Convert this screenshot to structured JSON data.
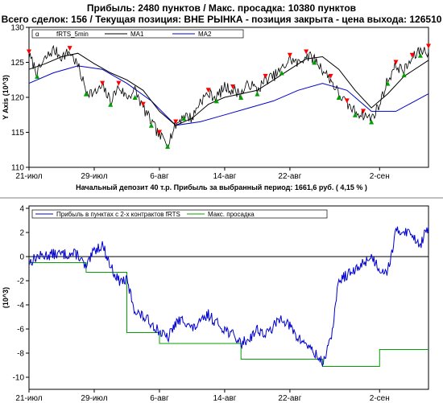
{
  "header": {
    "line1": "Прибыль: 2480 пунктов / Макс. просадка: 10380 пунктов",
    "line2": "Всего сделок: 156 /  Текущая позиция: ВНЕ РЫНКА - позиция закрыта  - цена выхода: 126510"
  },
  "colors": {
    "price": "#000000",
    "ma1": "#000000",
    "ma2": "#0000cc",
    "buy": "#00a000",
    "sell": "#ff0000",
    "profit": "#0000cc",
    "drawdown": "#00a000",
    "zero_line": "#000000",
    "separator": "#808080"
  },
  "chart_data": [
    {
      "type": "line",
      "ylabel": "Y Axis (10^3)",
      "ylim": [
        110,
        130
      ],
      "yticks": [
        110,
        115,
        120,
        125,
        130
      ],
      "xlim": [
        "2014-07-21",
        "2014-09-08"
      ],
      "xticks": [
        {
          "date": "2014-07-21",
          "label": "21-июл"
        },
        {
          "date": "2014-07-29",
          "label": "29-июл"
        },
        {
          "date": "2014-08-06",
          "label": "6-авг"
        },
        {
          "date": "2014-08-14",
          "label": "14-авг"
        },
        {
          "date": "2014-08-22",
          "label": "22-авг"
        },
        {
          "date": "2014-09-02",
          "label": "2-сен"
        }
      ],
      "grid": false,
      "legend": {
        "position": "top-left",
        "entries": [
          "fRTS_5min",
          "MA1",
          "MA2"
        ]
      },
      "caption": "Начальный депозит 40 т.р. Прибыль за выбранный период: 1661,6 руб. ( 4,15 % )",
      "series": [
        {
          "name": "fRTS_5min",
          "points": [
            {
              "x": "2014-07-21",
              "y": 126.0
            },
            {
              "x": "2014-07-22",
              "y": 123.5
            },
            {
              "x": "2014-07-23",
              "y": 125.5
            },
            {
              "x": "2014-07-24",
              "y": 126.8
            },
            {
              "x": "2014-07-25",
              "y": 125.8
            },
            {
              "x": "2014-07-26",
              "y": 126.5
            },
            {
              "x": "2014-07-27",
              "y": 124.5
            },
            {
              "x": "2014-07-28",
              "y": 121.0
            },
            {
              "x": "2014-07-29",
              "y": 120.5
            },
            {
              "x": "2014-07-30",
              "y": 121.5
            },
            {
              "x": "2014-07-31",
              "y": 119.5
            },
            {
              "x": "2014-08-01",
              "y": 121.5
            },
            {
              "x": "2014-08-02",
              "y": 120.0
            },
            {
              "x": "2014-08-03",
              "y": 121.0
            },
            {
              "x": "2014-08-04",
              "y": 118.5
            },
            {
              "x": "2014-08-05",
              "y": 116.5
            },
            {
              "x": "2014-08-06",
              "y": 114.5
            },
            {
              "x": "2014-08-07",
              "y": 113.5
            },
            {
              "x": "2014-08-08",
              "y": 116.0
            },
            {
              "x": "2014-08-09",
              "y": 117.5
            },
            {
              "x": "2014-08-10",
              "y": 117.0
            },
            {
              "x": "2014-08-11",
              "y": 119.5
            },
            {
              "x": "2014-08-12",
              "y": 120.5
            },
            {
              "x": "2014-08-13",
              "y": 120.0
            },
            {
              "x": "2014-08-14",
              "y": 121.5
            },
            {
              "x": "2014-08-15",
              "y": 121.0
            },
            {
              "x": "2014-08-16",
              "y": 120.5
            },
            {
              "x": "2014-08-17",
              "y": 122.0
            },
            {
              "x": "2014-08-18",
              "y": 121.0
            },
            {
              "x": "2014-08-19",
              "y": 122.5
            },
            {
              "x": "2014-08-20",
              "y": 123.0
            },
            {
              "x": "2014-08-21",
              "y": 124.0
            },
            {
              "x": "2014-08-22",
              "y": 125.5
            },
            {
              "x": "2014-08-23",
              "y": 124.8
            },
            {
              "x": "2014-08-24",
              "y": 126.0
            },
            {
              "x": "2014-08-25",
              "y": 125.5
            },
            {
              "x": "2014-08-26",
              "y": 124.0
            },
            {
              "x": "2014-08-27",
              "y": 122.5
            },
            {
              "x": "2014-08-28",
              "y": 120.5
            },
            {
              "x": "2014-08-29",
              "y": 119.0
            },
            {
              "x": "2014-08-30",
              "y": 118.0
            },
            {
              "x": "2014-08-31",
              "y": 117.5
            },
            {
              "x": "2014-09-01",
              "y": 117.0
            },
            {
              "x": "2014-09-02",
              "y": 119.0
            },
            {
              "x": "2014-09-03",
              "y": 122.5
            },
            {
              "x": "2014-09-04",
              "y": 124.5
            },
            {
              "x": "2014-09-05",
              "y": 123.8
            },
            {
              "x": "2014-09-06",
              "y": 125.5
            },
            {
              "x": "2014-09-07",
              "y": 126.8
            },
            {
              "x": "2014-09-08",
              "y": 126.5
            }
          ]
        },
        {
          "name": "MA1",
          "points": [
            {
              "x": "2014-07-21",
              "y": 124.0
            },
            {
              "x": "2014-07-23",
              "y": 124.8
            },
            {
              "x": "2014-07-25",
              "y": 125.8
            },
            {
              "x": "2014-07-27",
              "y": 126.3
            },
            {
              "x": "2014-07-29",
              "y": 124.8
            },
            {
              "x": "2014-07-31",
              "y": 123.5
            },
            {
              "x": "2014-08-02",
              "y": 122.5
            },
            {
              "x": "2014-08-04",
              "y": 121.0
            },
            {
              "x": "2014-08-06",
              "y": 118.0
            },
            {
              "x": "2014-08-08",
              "y": 116.0
            },
            {
              "x": "2014-08-10",
              "y": 117.0
            },
            {
              "x": "2014-08-12",
              "y": 119.0
            },
            {
              "x": "2014-08-14",
              "y": 120.0
            },
            {
              "x": "2014-08-16",
              "y": 120.5
            },
            {
              "x": "2014-08-18",
              "y": 121.0
            },
            {
              "x": "2014-08-20",
              "y": 122.5
            },
            {
              "x": "2014-08-22",
              "y": 124.0
            },
            {
              "x": "2014-08-24",
              "y": 125.5
            },
            {
              "x": "2014-08-26",
              "y": 125.8
            },
            {
              "x": "2014-08-28",
              "y": 124.0
            },
            {
              "x": "2014-08-30",
              "y": 121.0
            },
            {
              "x": "2014-09-01",
              "y": 118.5
            },
            {
              "x": "2014-09-03",
              "y": 120.5
            },
            {
              "x": "2014-09-05",
              "y": 123.0
            },
            {
              "x": "2014-09-08",
              "y": 125.3
            }
          ]
        },
        {
          "name": "MA2",
          "points": [
            {
              "x": "2014-07-21",
              "y": 122.0
            },
            {
              "x": "2014-07-24",
              "y": 123.5
            },
            {
              "x": "2014-07-27",
              "y": 124.5
            },
            {
              "x": "2014-07-30",
              "y": 124.0
            },
            {
              "x": "2014-08-02",
              "y": 122.0
            },
            {
              "x": "2014-08-05",
              "y": 119.5
            },
            {
              "x": "2014-08-08",
              "y": 116.0
            },
            {
              "x": "2014-08-11",
              "y": 116.5
            },
            {
              "x": "2014-08-14",
              "y": 117.5
            },
            {
              "x": "2014-08-17",
              "y": 118.5
            },
            {
              "x": "2014-08-20",
              "y": 119.5
            },
            {
              "x": "2014-08-23",
              "y": 121.0
            },
            {
              "x": "2014-08-26",
              "y": 122.0
            },
            {
              "x": "2014-08-29",
              "y": 121.0
            },
            {
              "x": "2014-09-01",
              "y": 118.0
            },
            {
              "x": "2014-09-04",
              "y": 118.0
            },
            {
              "x": "2014-09-08",
              "y": 120.5
            }
          ]
        }
      ],
      "signals": {
        "buy": [
          {
            "x": "2014-07-22",
            "y": 123.0
          },
          {
            "x": "2014-07-28",
            "y": 120.5
          },
          {
            "x": "2014-07-31",
            "y": 119.0
          },
          {
            "x": "2014-08-03",
            "y": 120.0
          },
          {
            "x": "2014-08-05",
            "y": 116.0
          },
          {
            "x": "2014-08-07",
            "y": 113.0
          },
          {
            "x": "2014-08-09",
            "y": 117.0
          },
          {
            "x": "2014-08-13",
            "y": 119.5
          },
          {
            "x": "2014-08-16",
            "y": 120.0
          },
          {
            "x": "2014-08-18",
            "y": 120.5
          },
          {
            "x": "2014-08-21",
            "y": 123.5
          },
          {
            "x": "2014-08-25",
            "y": 125.0
          },
          {
            "x": "2014-08-28",
            "y": 120.0
          },
          {
            "x": "2014-08-30",
            "y": 117.5
          },
          {
            "x": "2014-09-01",
            "y": 116.5
          },
          {
            "x": "2014-09-03",
            "y": 122.0
          },
          {
            "x": "2014-09-05",
            "y": 123.2
          },
          {
            "x": "2014-09-07",
            "y": 126.0
          }
        ],
        "sell": [
          {
            "x": "2014-07-21",
            "y": 126.5
          },
          {
            "x": "2014-07-26",
            "y": 127.0
          },
          {
            "x": "2014-07-30",
            "y": 122.0
          },
          {
            "x": "2014-08-01",
            "y": 122.0
          },
          {
            "x": "2014-08-04",
            "y": 119.0
          },
          {
            "x": "2014-08-06",
            "y": 115.0
          },
          {
            "x": "2014-08-08",
            "y": 116.5
          },
          {
            "x": "2014-08-12",
            "y": 121.0
          },
          {
            "x": "2014-08-15",
            "y": 121.5
          },
          {
            "x": "2014-08-19",
            "y": 123.0
          },
          {
            "x": "2014-08-22",
            "y": 126.0
          },
          {
            "x": "2014-08-24",
            "y": 126.5
          },
          {
            "x": "2014-08-27",
            "y": 123.0
          },
          {
            "x": "2014-08-29",
            "y": 119.5
          },
          {
            "x": "2014-08-31",
            "y": 118.0
          },
          {
            "x": "2014-09-04",
            "y": 125.0
          },
          {
            "x": "2014-09-06",
            "y": 126.0
          },
          {
            "x": "2014-09-08",
            "y": 127.3
          }
        ]
      }
    },
    {
      "type": "line",
      "ylabel": "(10^3)",
      "ylim": [
        -11,
        4.2
      ],
      "yticks": [
        {
          "value": 4,
          "label": "4"
        },
        {
          "value": 2,
          "label": "2"
        },
        {
          "value": 0,
          "label": "0"
        },
        {
          "value": -2,
          "label": "-2"
        },
        {
          "value": -4,
          "label": "-4"
        },
        {
          "value": -6,
          "label": "-6"
        },
        {
          "value": -8,
          "label": "-8"
        },
        {
          "value": -10,
          "label": "-10"
        }
      ],
      "xlim": [
        "2014-07-21",
        "2014-09-08"
      ],
      "xticks": [
        {
          "date": "2014-07-21",
          "label": "21-июл"
        },
        {
          "date": "2014-07-29",
          "label": "29-июл"
        },
        {
          "date": "2014-08-06",
          "label": "6-авг"
        },
        {
          "date": "2014-08-14",
          "label": "14-авг"
        },
        {
          "date": "2014-08-22",
          "label": "22-авг"
        },
        {
          "date": "2014-09-02",
          "label": "2-сен"
        }
      ],
      "grid": false,
      "legend": {
        "position": "top-left",
        "entries": [
          "Прибыль в пунктах с 2-х контрактов fRTS",
          "Макс. просадка"
        ]
      },
      "series": [
        {
          "name": "Прибыль в пунктах с 2-х контрактов fRTS",
          "points": [
            {
              "x": "2014-07-21",
              "y": -0.5
            },
            {
              "x": "2014-07-22",
              "y": 0.0
            },
            {
              "x": "2014-07-24",
              "y": 0.2
            },
            {
              "x": "2014-07-27",
              "y": 0.2
            },
            {
              "x": "2014-07-28",
              "y": -1.0
            },
            {
              "x": "2014-07-29",
              "y": 0.5
            },
            {
              "x": "2014-07-30",
              "y": 1.0
            },
            {
              "x": "2014-07-31",
              "y": -0.8
            },
            {
              "x": "2014-08-01",
              "y": -2.0
            },
            {
              "x": "2014-08-02",
              "y": -2.0
            },
            {
              "x": "2014-08-03",
              "y": -4.5
            },
            {
              "x": "2014-08-04",
              "y": -5.0
            },
            {
              "x": "2014-08-05",
              "y": -5.5
            },
            {
              "x": "2014-08-06",
              "y": -6.2
            },
            {
              "x": "2014-08-07",
              "y": -6.8
            },
            {
              "x": "2014-08-08",
              "y": -5.5
            },
            {
              "x": "2014-08-09",
              "y": -5.2
            },
            {
              "x": "2014-08-10",
              "y": -6.0
            },
            {
              "x": "2014-08-11",
              "y": -5.5
            },
            {
              "x": "2014-08-12",
              "y": -4.8
            },
            {
              "x": "2014-08-13",
              "y": -5.5
            },
            {
              "x": "2014-08-14",
              "y": -6.0
            },
            {
              "x": "2014-08-15",
              "y": -6.5
            },
            {
              "x": "2014-08-16",
              "y": -7.2
            },
            {
              "x": "2014-08-17",
              "y": -6.8
            },
            {
              "x": "2014-08-18",
              "y": -6.0
            },
            {
              "x": "2014-08-19",
              "y": -6.5
            },
            {
              "x": "2014-08-20",
              "y": -5.8
            },
            {
              "x": "2014-08-21",
              "y": -5.0
            },
            {
              "x": "2014-08-22",
              "y": -5.8
            },
            {
              "x": "2014-08-23",
              "y": -6.8
            },
            {
              "x": "2014-08-24",
              "y": -7.2
            },
            {
              "x": "2014-08-25",
              "y": -8.0
            },
            {
              "x": "2014-08-26",
              "y": -8.8
            },
            {
              "x": "2014-08-27",
              "y": -7.0
            },
            {
              "x": "2014-08-28",
              "y": -2.0
            },
            {
              "x": "2014-08-29",
              "y": -1.5
            },
            {
              "x": "2014-08-30",
              "y": -1.2
            },
            {
              "x": "2014-08-31",
              "y": -0.5
            },
            {
              "x": "2014-09-01",
              "y": 0.0
            },
            {
              "x": "2014-09-02",
              "y": -1.0
            },
            {
              "x": "2014-09-03",
              "y": -1.2
            },
            {
              "x": "2014-09-04",
              "y": 2.0
            },
            {
              "x": "2014-09-05",
              "y": 2.2
            },
            {
              "x": "2014-09-06",
              "y": 1.8
            },
            {
              "x": "2014-09-07",
              "y": 1.0
            },
            {
              "x": "2014-09-08",
              "y": 2.5
            }
          ]
        },
        {
          "name": "Макс. просадка",
          "points": [
            {
              "x": "2014-07-21",
              "y": -0.5
            },
            {
              "x": "2014-07-28",
              "y": -0.5
            },
            {
              "x": "2014-07-28",
              "y": -1.3
            },
            {
              "x": "2014-08-02",
              "y": -1.3
            },
            {
              "x": "2014-08-02",
              "y": -6.3
            },
            {
              "x": "2014-08-06",
              "y": -6.3
            },
            {
              "x": "2014-08-06",
              "y": -7.2
            },
            {
              "x": "2014-08-16",
              "y": -7.2
            },
            {
              "x": "2014-08-16",
              "y": -8.5
            },
            {
              "x": "2014-08-26",
              "y": -8.5
            },
            {
              "x": "2014-08-26",
              "y": -9.1
            },
            {
              "x": "2014-09-02",
              "y": -9.1
            },
            {
              "x": "2014-09-02",
              "y": -7.7
            },
            {
              "x": "2014-09-08",
              "y": -7.7
            }
          ]
        }
      ]
    }
  ]
}
